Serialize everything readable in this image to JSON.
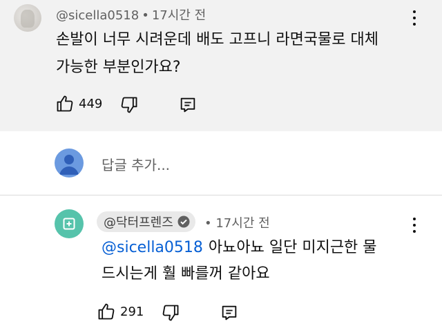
{
  "comment": {
    "author": "@sicella0518",
    "separator": "•",
    "time": "17시간 전",
    "text_line1": "손발이 너무 시려운데 배도 고프니 라면국물로 대체",
    "text_line2": "가능한 부분인가요?",
    "like_count": "449"
  },
  "add_reply": {
    "placeholder": "답글 추가..."
  },
  "reply": {
    "author": "@닥터프렌즈",
    "separator": "•",
    "time": "17시간 전",
    "mention": "@sicella0518",
    "text_line1": "아뇨아뇨 일단 미지근한 물",
    "text_line2": "드시는게 훨 빠를꺼 같아요",
    "like_count": "291"
  },
  "icons": {
    "like": "thumbs-up-icon",
    "dislike": "thumbs-down-icon",
    "reply": "reply-comment-icon",
    "more": "more-vertical-icon",
    "verified": "verified-check-icon"
  },
  "colors": {
    "highlight_bg": "#f2f2f2",
    "mention_link": "#065fd4",
    "reply_avatar": "#56c3ab",
    "user_avatar": "#6b9ae0"
  }
}
